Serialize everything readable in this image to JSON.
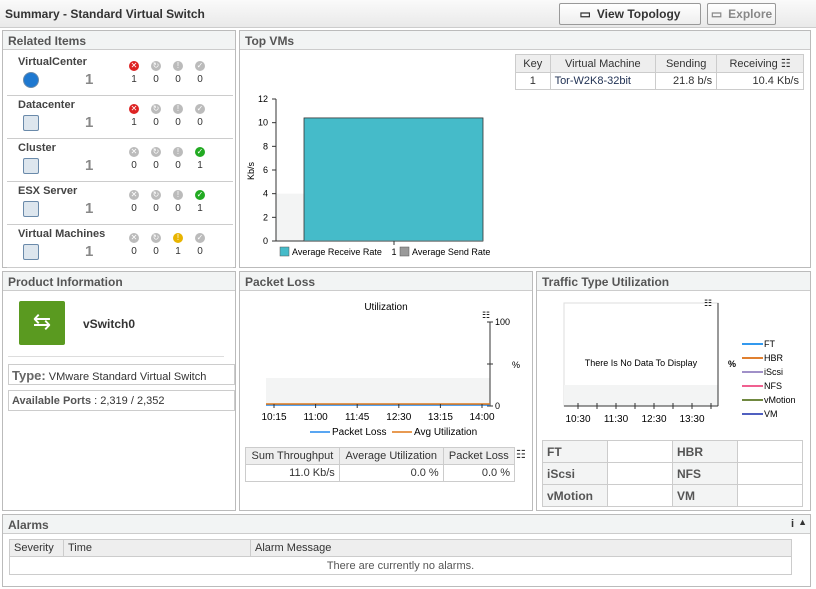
{
  "header": {
    "title": "Summary - Standard Virtual Switch",
    "view_topology": "View Topology",
    "explore": "Explore"
  },
  "related": {
    "title": "Related Items",
    "items": [
      {
        "name": "VirtualCenter",
        "icon": "virtualcenter-icon",
        "count": "1",
        "states": [
          "1",
          "0",
          "0",
          "0"
        ],
        "active": [
          true,
          false,
          false,
          false
        ]
      },
      {
        "name": "Datacenter",
        "icon": "datacenter-icon",
        "count": "1",
        "states": [
          "1",
          "0",
          "0",
          "0"
        ],
        "active": [
          true,
          false,
          false,
          false
        ]
      },
      {
        "name": "Cluster",
        "icon": "cluster-icon",
        "count": "1",
        "states": [
          "0",
          "0",
          "0",
          "1"
        ],
        "active": [
          false,
          false,
          false,
          true
        ]
      },
      {
        "name": "ESX Server",
        "icon": "server-icon",
        "count": "1",
        "states": [
          "0",
          "0",
          "0",
          "1"
        ],
        "active": [
          false,
          false,
          false,
          true
        ]
      },
      {
        "name": "Virtual Machines",
        "icon": "vm-icon",
        "count": "1",
        "states": [
          "0",
          "0",
          "1",
          "0"
        ],
        "active": [
          false,
          false,
          true,
          false
        ]
      }
    ]
  },
  "topvms": {
    "title": "Top VMs",
    "table": {
      "headers": [
        "Key",
        "Virtual Machine",
        "Sending",
        "Receiving"
      ],
      "rows": [
        [
          "1",
          "Tor-W2K8-32bit",
          "21.8 b/s",
          "10.4 Kb/s"
        ]
      ]
    }
  },
  "chart_data": [
    {
      "type": "bar",
      "title": "Top VMs",
      "categories": [
        "1"
      ],
      "ylabel": "Kb/s",
      "ylim": [
        0,
        12
      ],
      "yticks": [
        "0",
        "2",
        "4",
        "6",
        "8",
        "10",
        "12"
      ],
      "series": [
        {
          "name": "Average Receive Rate",
          "values": [
            10.4
          ],
          "color": "#45bbc9"
        },
        {
          "name": "Average Send Rate",
          "values": [
            0.0218
          ],
          "color": "#999999"
        }
      ]
    },
    {
      "type": "line",
      "title": "Utilization",
      "x": [
        "10:15",
        "11:00",
        "11:45",
        "12:30",
        "13:15",
        "14:00"
      ],
      "ylabel": "%",
      "ylim": [
        0,
        100
      ],
      "yticks": [
        "0",
        "100"
      ],
      "series": [
        {
          "name": "Packet Loss",
          "values": [
            0,
            0,
            0,
            0,
            0,
            0
          ],
          "color": "#2288ee"
        },
        {
          "name": "Avg Utilization",
          "values": [
            0,
            0,
            0,
            0,
            0,
            0
          ],
          "color": "#e07818"
        }
      ]
    },
    {
      "type": "line",
      "title": "Traffic Type Utilization",
      "x": [
        "10:30",
        "11:30",
        "12:30",
        "13:30"
      ],
      "ylabel": "%",
      "empty": "There Is No Data To Display",
      "series": [
        {
          "name": "FT",
          "color": "#3399ee"
        },
        {
          "name": "HBR",
          "color": "#e08030"
        },
        {
          "name": "iScsi",
          "color": "#a090c8"
        },
        {
          "name": "NFS",
          "color": "#f06090"
        },
        {
          "name": "vMotion",
          "color": "#708840"
        },
        {
          "name": "VM",
          "color": "#5060c0"
        }
      ]
    }
  ],
  "product": {
    "title": "Product Information",
    "name": "vSwitch0",
    "type_label": "Type:",
    "type_value": "VMware Standard Virtual Switch",
    "ports_label": "Available Ports",
    "ports_value": ": 2,319 / 2,352"
  },
  "packet": {
    "title": "Packet Loss",
    "table": {
      "headers": [
        "Sum Throughput",
        "Average Utilization",
        "Packet Loss"
      ],
      "row": [
        "11.0 Kb/s",
        "0.0 %",
        "0.0 %"
      ]
    }
  },
  "traffic": {
    "title": "Traffic Type Utilization",
    "grid": [
      [
        "FT",
        "",
        "HBR",
        ""
      ],
      [
        "iScsi",
        "",
        "NFS",
        ""
      ],
      [
        "vMotion",
        "",
        "VM",
        ""
      ]
    ]
  },
  "alarms": {
    "title": "Alarms",
    "headers": [
      "Severity",
      "Time",
      "Alarm Message"
    ],
    "empty": "There are currently no alarms."
  }
}
